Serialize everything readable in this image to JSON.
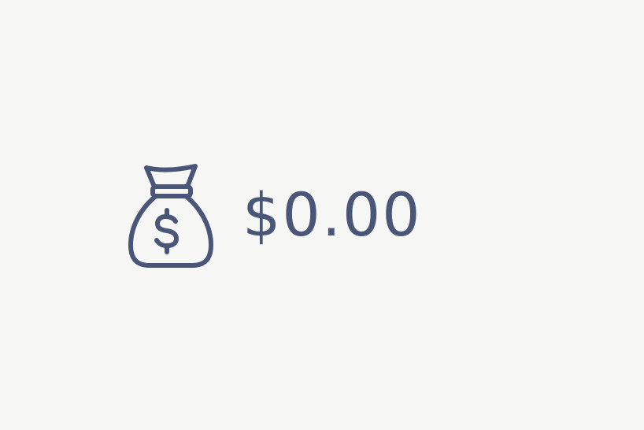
{
  "balance": {
    "amount": "$0.00",
    "icon": "money-bag-icon"
  },
  "colors": {
    "background": "#f6f6f5",
    "accent": "#4a5678"
  }
}
